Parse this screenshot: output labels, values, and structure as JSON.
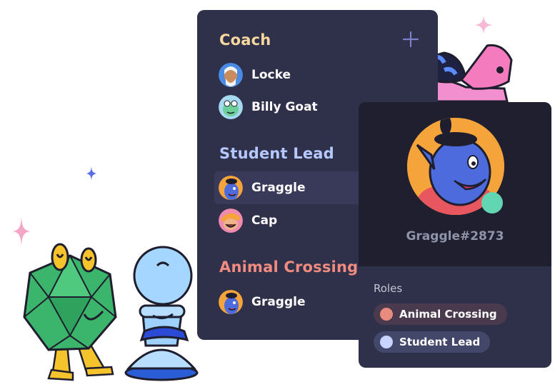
{
  "member_list": {
    "groups": [
      {
        "title": "Coach",
        "color": "#f7d89e",
        "members": [
          {
            "name": "Locke",
            "avatar_icon": "locke-avatar"
          },
          {
            "name": "Billy Goat",
            "avatar_icon": "billy-goat-avatar"
          }
        ]
      },
      {
        "title": "Student Lead",
        "color": "#b5c8ff",
        "members": [
          {
            "name": "Graggle",
            "avatar_icon": "graggle-avatar",
            "selected": true
          },
          {
            "name": "Cap",
            "avatar_icon": "cap-avatar"
          }
        ]
      },
      {
        "title": "Animal Crossing",
        "color": "#f08b80",
        "members": [
          {
            "name": "Graggle",
            "avatar_icon": "graggle-avatar"
          }
        ]
      }
    ],
    "add_icon": "plus-icon"
  },
  "profile": {
    "username": "Graggle#2873",
    "status": "online",
    "roles_title": "Roles",
    "roles": [
      {
        "name": "Animal Crossing",
        "color": "#e88b7e",
        "bg": "#4a3a4e"
      },
      {
        "name": "Student Lead",
        "color": "#c8d4ff",
        "bg": "#43476a"
      }
    ]
  },
  "colors": {
    "panel": "#2f3049",
    "card_top": "#1f1f30",
    "status_online": "#62d5b2",
    "accent_purple": "#7b80c9"
  }
}
